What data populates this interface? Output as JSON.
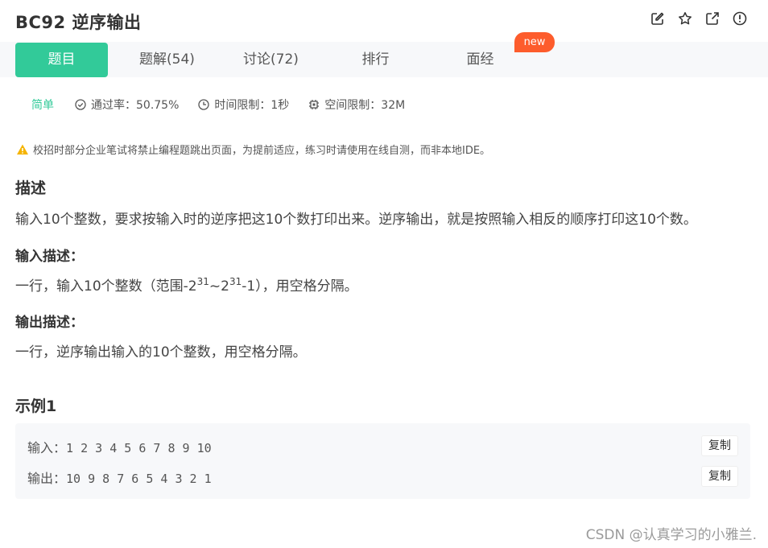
{
  "header": {
    "title": "BC92  逆序输出",
    "icons": [
      "edit-icon",
      "star-icon",
      "share-icon",
      "report-icon"
    ]
  },
  "tabs": [
    {
      "label": "题目",
      "active": true
    },
    {
      "label": "题解(54)",
      "active": false
    },
    {
      "label": "讨论(72)",
      "active": false
    },
    {
      "label": "排行",
      "active": false
    },
    {
      "label": "面经",
      "active": false
    }
  ],
  "new_badge": "new",
  "meta": {
    "level": "简单",
    "pass_rate": "通过率：50.75%",
    "time_limit": "时间限制：1秒",
    "space_limit": "空间限制：32M"
  },
  "warning": "校招时部分企业笔试将禁止编程题跳出页面，为提前适应，练习时请使用在线自测，而非本地IDE。",
  "description": {
    "heading": "描述",
    "text": "输入10个整数，要求按输入时的逆序把这10个数打印出来。逆序输出，就是按照输入相反的顺序打印这10个数。"
  },
  "input_desc": {
    "heading": "输入描述：",
    "text_a": "一行，输入10个整数（范围-2",
    "sup1": "31",
    "text_b": "~2",
    "sup2": "31",
    "text_c": "-1），用空格分隔。"
  },
  "output_desc": {
    "heading": "输出描述：",
    "text": "一行，逆序输出输入的10个整数，用空格分隔。"
  },
  "example": {
    "heading": "示例1",
    "input_label": "输入：",
    "input_value": "1 2 3 4 5 6 7 8 9 10",
    "output_label": "输出：",
    "output_value": "10 9 8 7 6 5 4 3 2 1",
    "copy_label": "复制"
  },
  "watermark": "CSDN @认真学习的小雅兰.",
  "colors": {
    "accent": "#32ca99",
    "badge": "#fd5c2c",
    "warning": "#f5b400"
  }
}
